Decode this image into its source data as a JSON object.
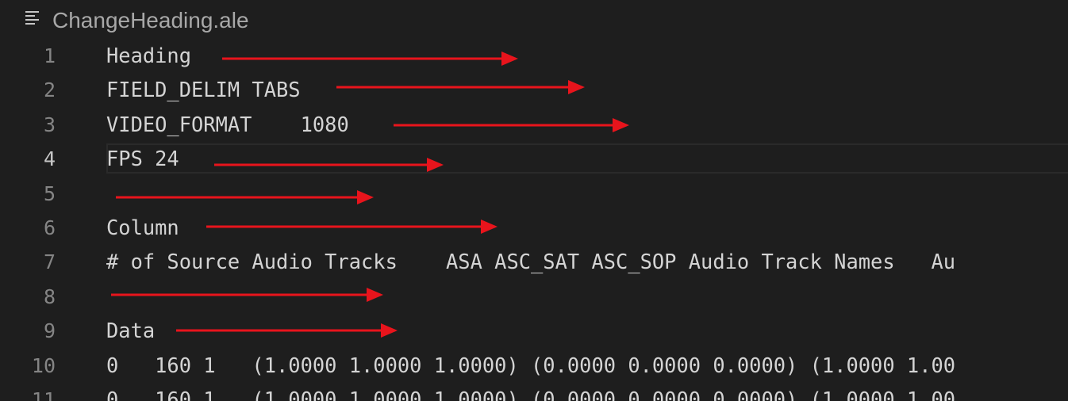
{
  "file": {
    "title": "ChangeHeading.ale",
    "icon": "outline-list-icon"
  },
  "editor": {
    "current_line": 4,
    "lines": [
      {
        "number": "1",
        "text": "Heading"
      },
      {
        "number": "2",
        "text": "FIELD_DELIM TABS"
      },
      {
        "number": "3",
        "text": "VIDEO_FORMAT    1080"
      },
      {
        "number": "4",
        "text": "FPS 24"
      },
      {
        "number": "5",
        "text": ""
      },
      {
        "number": "6",
        "text": "Column"
      },
      {
        "number": "7",
        "text": "# of Source Audio Tracks    ASA ASC_SAT ASC_SOP Audio Track Names   Au"
      },
      {
        "number": "8",
        "text": ""
      },
      {
        "number": "9",
        "text": "Data"
      },
      {
        "number": "10",
        "text": "0   160 1   (1.0000 1.0000 1.0000) (0.0000 0.0000 0.0000) (1.0000 1.00"
      },
      {
        "number": "11",
        "text": "0   160 1   (1.0000 1.0000 1.0000) (0.0000 0.0000 0.0000) (1.0000 1.00"
      }
    ]
  },
  "annotations": {
    "arrow_color": "#e8141c"
  },
  "colors": {
    "background": "#1e1e1e",
    "text": "#d4d4d4",
    "line_number": "#858585",
    "title": "#a8a8a8"
  }
}
